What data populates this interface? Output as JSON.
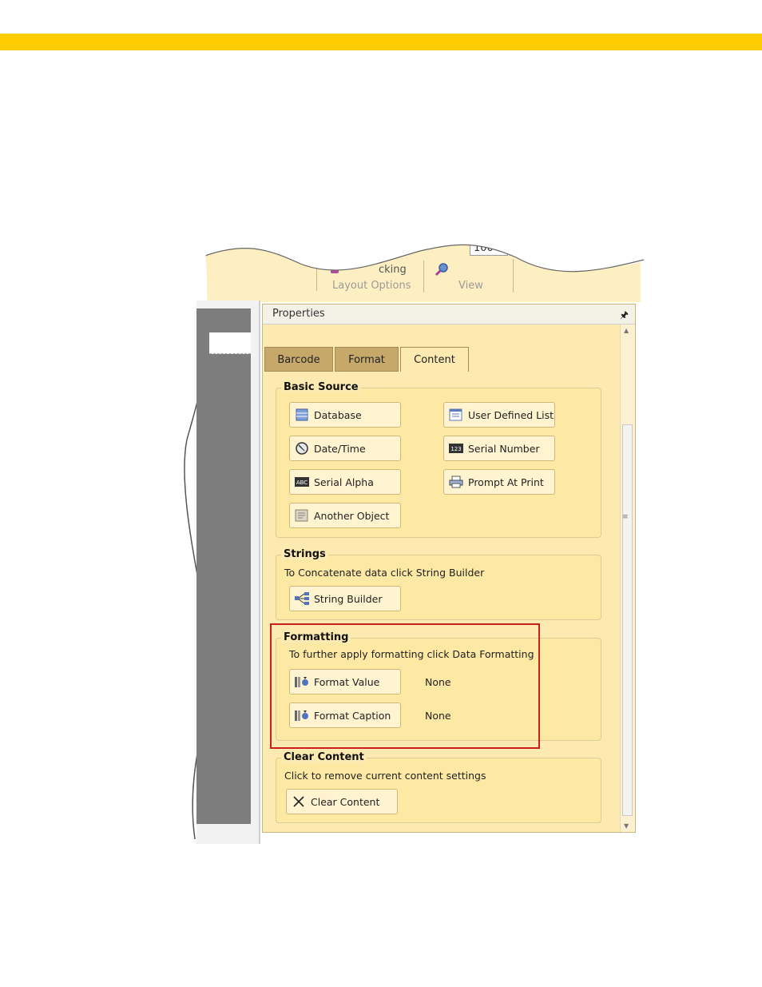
{
  "ribbon": {
    "partial_text": "cking",
    "zoom_value": "100",
    "layout_options_label": "Layout Options",
    "view_label": "View"
  },
  "panel": {
    "title": "Properties",
    "tabs": [
      {
        "label": "Barcode"
      },
      {
        "label": "Format"
      },
      {
        "label": "Content"
      }
    ]
  },
  "basic_source": {
    "title": "Basic Source",
    "buttons": {
      "database": "Database",
      "user_defined_list": "User Defined List",
      "date_time": "Date/Time",
      "serial_number": "Serial Number",
      "serial_alpha": "Serial Alpha",
      "prompt_at_print": "Prompt At Print",
      "another_object": "Another Object"
    }
  },
  "strings": {
    "title": "Strings",
    "note": "To Concatenate data click String Builder",
    "button": "String Builder"
  },
  "formatting": {
    "title": "Formatting",
    "note": "To further apply formatting click Data Formatting",
    "format_value_button": "Format Value",
    "format_value": "None",
    "format_caption_button": "Format Caption",
    "format_caption": "None"
  },
  "clear_content": {
    "title": "Clear Content",
    "note": "Click to remove current content settings",
    "button": "Clear Content"
  },
  "colors": {
    "accent_bar": "#ffcc00",
    "panel_bg": "#fdeab0",
    "highlight": "#cc1f1f"
  }
}
